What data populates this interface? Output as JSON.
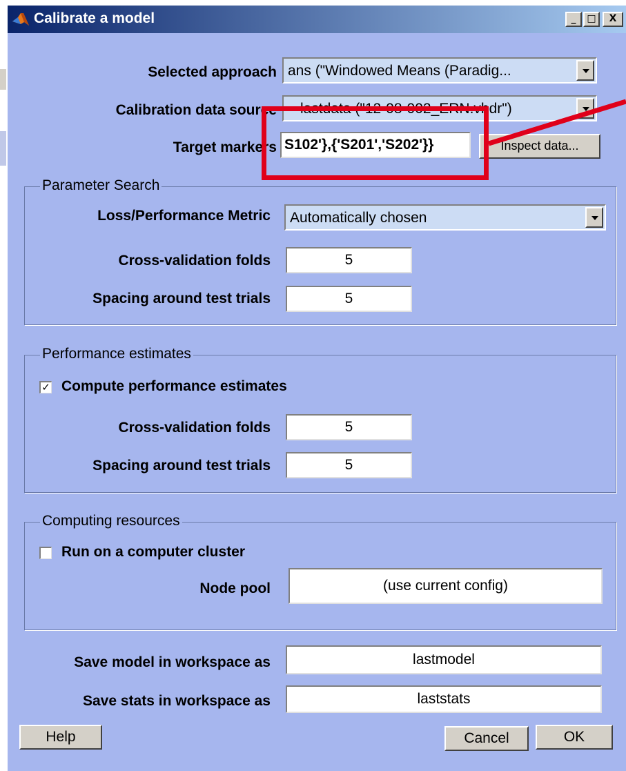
{
  "window": {
    "title": "Calibrate a model",
    "controls": {
      "minimize": "_",
      "maximize": "□",
      "close": "X"
    }
  },
  "fields": {
    "selected_approach": {
      "label": "Selected approach",
      "value": "ans (\"Windowed Means (Paradig..."
    },
    "calibration_data_source": {
      "label": "Calibration data source",
      "value": "lastdata (\"12-08-002_ERN.vhdr\")"
    },
    "target_markers": {
      "label": "Target markers",
      "value": "S102'},{'S201','S202'}}"
    },
    "inspect_button": "Inspect data..."
  },
  "parameter_search": {
    "title": "Parameter Search",
    "metric_label": "Loss/Performance Metric",
    "metric_value": "Automatically chosen",
    "folds_label": "Cross-validation folds",
    "folds_value": "5",
    "spacing_label": "Spacing around test trials",
    "spacing_value": "5"
  },
  "performance": {
    "title": "Performance estimates",
    "compute_label": "Compute performance estimates",
    "compute_checked": true,
    "check_mark": "✓",
    "folds_label": "Cross-validation folds",
    "folds_value": "5",
    "spacing_label": "Spacing around test trials",
    "spacing_value": "5"
  },
  "computing": {
    "title": "Computing resources",
    "cluster_label": "Run on a computer cluster",
    "cluster_checked": false,
    "node_pool_label": "Node pool",
    "node_pool_value": "(use current config)"
  },
  "save": {
    "model_label": "Save model in workspace as",
    "model_value": "lastmodel",
    "stats_label": "Save stats in workspace as",
    "stats_value": "laststats"
  },
  "buttons": {
    "help": "Help",
    "cancel": "Cancel",
    "ok": "OK"
  },
  "colors": {
    "window_bg": "#a6b6ee",
    "title_gradient_start": "#0a246a",
    "title_gradient_end": "#a6caf0",
    "highlight": "#e0001a"
  }
}
